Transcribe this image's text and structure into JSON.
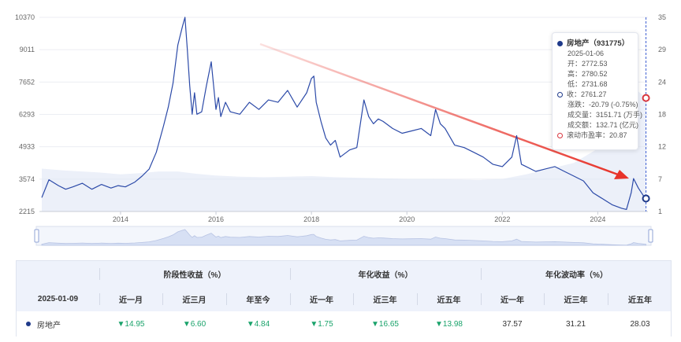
{
  "chart_data": {
    "type": "line",
    "y_left_ticks": [
      "10370",
      "9011",
      "7652",
      "6293",
      "4933",
      "3574",
      "2215"
    ],
    "y_right_ticks": [
      "35",
      "29",
      "24",
      "18",
      "12",
      "7",
      "1"
    ],
    "x_ticks": [
      "2014",
      "2016",
      "2018",
      "2020",
      "2022",
      "2024"
    ],
    "ylim": [
      2215,
      10370
    ],
    "y_right_lim": [
      1,
      35
    ],
    "xlim": [
      2012.3,
      2025.05
    ],
    "grid": true,
    "series": [
      {
        "name": "房地产",
        "axis": "left",
        "color": "#2c4aa8",
        "x": [
          2012.35,
          2012.5,
          2012.7,
          2012.85,
          2013.0,
          2013.2,
          2013.4,
          2013.6,
          2013.8,
          2013.95,
          2014.1,
          2014.3,
          2014.45,
          2014.6,
          2014.75,
          2014.9,
          2015.0,
          2015.1,
          2015.2,
          2015.3,
          2015.35,
          2015.4,
          2015.45,
          2015.5,
          2015.55,
          2015.6,
          2015.7,
          2015.8,
          2015.9,
          2016.0,
          2016.05,
          2016.1,
          2016.2,
          2016.3,
          2016.5,
          2016.7,
          2016.9,
          2017.1,
          2017.3,
          2017.5,
          2017.7,
          2017.9,
          2018.0,
          2018.05,
          2018.1,
          2018.2,
          2018.3,
          2018.4,
          2018.5,
          2018.6,
          2018.8,
          2018.95,
          2019.1,
          2019.2,
          2019.3,
          2019.4,
          2019.5,
          2019.7,
          2019.9,
          2020.1,
          2020.3,
          2020.5,
          2020.6,
          2020.7,
          2020.8,
          2021.0,
          2021.2,
          2021.4,
          2021.6,
          2021.8,
          2022.0,
          2022.2,
          2022.3,
          2022.4,
          2022.5,
          2022.7,
          2022.9,
          2023.1,
          2023.3,
          2023.5,
          2023.7,
          2023.9,
          2024.1,
          2024.3,
          2024.5,
          2024.6,
          2024.7,
          2024.75,
          2024.85,
          2024.95,
          2025.01
        ],
        "y": [
          2800,
          3550,
          3300,
          3150,
          3250,
          3400,
          3150,
          3350,
          3200,
          3300,
          3250,
          3450,
          3700,
          4000,
          4700,
          5800,
          6600,
          7600,
          9200,
          10000,
          10370,
          9000,
          7500,
          6300,
          7200,
          6300,
          6400,
          7500,
          8500,
          6500,
          7000,
          6200,
          6800,
          6400,
          6300,
          6800,
          6500,
          6900,
          6800,
          7300,
          6600,
          7200,
          7800,
          7900,
          6800,
          6000,
          5300,
          5000,
          5200,
          4500,
          4800,
          4900,
          6900,
          6200,
          5900,
          6100,
          6000,
          5700,
          5500,
          5600,
          5700,
          5400,
          6500,
          5900,
          5700,
          5000,
          4900,
          4700,
          4500,
          4200,
          4100,
          4500,
          5400,
          4200,
          4100,
          3900,
          4000,
          4100,
          3900,
          3700,
          3500,
          3000,
          2750,
          2500,
          2350,
          2300,
          3000,
          3600,
          3200,
          2900,
          2761
        ]
      },
      {
        "name": "滚动市盈率",
        "axis": "right",
        "color": "#c5cfe6",
        "x": [
          2012.35,
          2012.8,
          2013.2,
          2013.6,
          2014.0,
          2014.4,
          2014.8,
          2015.2,
          2015.6,
          2016.0,
          2016.5,
          2017.0,
          2017.5,
          2018.0,
          2018.5,
          2019.0,
          2019.5,
          2020.0,
          2020.5,
          2021.0,
          2021.5,
          2022.0,
          2022.5,
          2023.0,
          2023.5,
          2024.0,
          2024.3,
          2024.5,
          2024.7,
          2024.85,
          2025.01
        ],
        "y": [
          8.5,
          8.2,
          8.0,
          7.8,
          7.5,
          7.7,
          8.0,
          8.0,
          7.6,
          7.3,
          7.1,
          7.0,
          7.1,
          7.2,
          7.0,
          6.9,
          6.8,
          6.7,
          6.7,
          6.6,
          6.5,
          6.7,
          7.5,
          8.5,
          9.5,
          12.0,
          16.0,
          20.0,
          24.0,
          22.0,
          20.87
        ]
      }
    ],
    "tooltip": {
      "title": "房地产（931775）",
      "date": "2025-01-06",
      "open": "开：2772.53",
      "high": "高：2780.52",
      "low": "低：2731.68",
      "close": "收：2761.27",
      "change": "涨跌：-20.79 (-0.75%)",
      "volume": "成交量：3151.71 (万手)",
      "turnover": "成交额：132.71 (亿元)",
      "pe": "滚动市盈率：20.87"
    },
    "colors": {
      "price_line": "#2c4aa8",
      "pe_area": "#dfe6f5",
      "trend_arrow": "#e8332a",
      "pe_marker": "#d9363e",
      "slider_fill": "#d7e0f4"
    }
  },
  "table": {
    "date": "2025-01-09",
    "groups": [
      "阶段性收益（%）",
      "年化收益（%）",
      "年化波动率（%）"
    ],
    "columns": [
      "近一月",
      "近三月",
      "年至今",
      "近一年",
      "近三年",
      "近五年",
      "近一年",
      "近三年",
      "近五年"
    ],
    "row": {
      "name": "房地产",
      "values": [
        "▼14.95",
        "▼6.60",
        "▼4.84",
        "▼1.75",
        "▼16.65",
        "▼13.98",
        "37.57",
        "31.21",
        "28.03"
      ]
    }
  }
}
